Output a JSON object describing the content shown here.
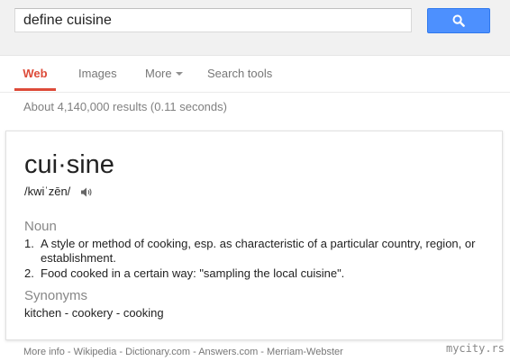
{
  "search": {
    "query": "define cuisine",
    "button_icon": "magnifier-icon",
    "button_color": "#4d90fe"
  },
  "tabs": {
    "web": "Web",
    "images": "Images",
    "more": "More",
    "search_tools": "Search tools",
    "active_color": "#dd4b39"
  },
  "result_stats": "About 4,140,000 results (0.11 seconds)",
  "definition": {
    "word": "cui·sine",
    "phonetic": "/kwiˈzēn/",
    "audio_icon": "speaker-icon",
    "part_of_speech": "Noun",
    "meanings": [
      {
        "number": "1.",
        "text": "A style or method of cooking, esp. as characteristic of a particular country, region, or establishment."
      },
      {
        "number": "2.",
        "text": "Food cooked in a certain way: \"sampling the local cuisine\"."
      }
    ],
    "synonyms_label": "Synonyms",
    "synonyms": "kitchen - cookery - cooking"
  },
  "footer": {
    "more_info": "More info",
    "separator": " - ",
    "links": [
      "Wikipedia",
      "Dictionary.com",
      "Answers.com",
      "Merriam-Webster"
    ]
  },
  "watermark": "mycity.rs"
}
